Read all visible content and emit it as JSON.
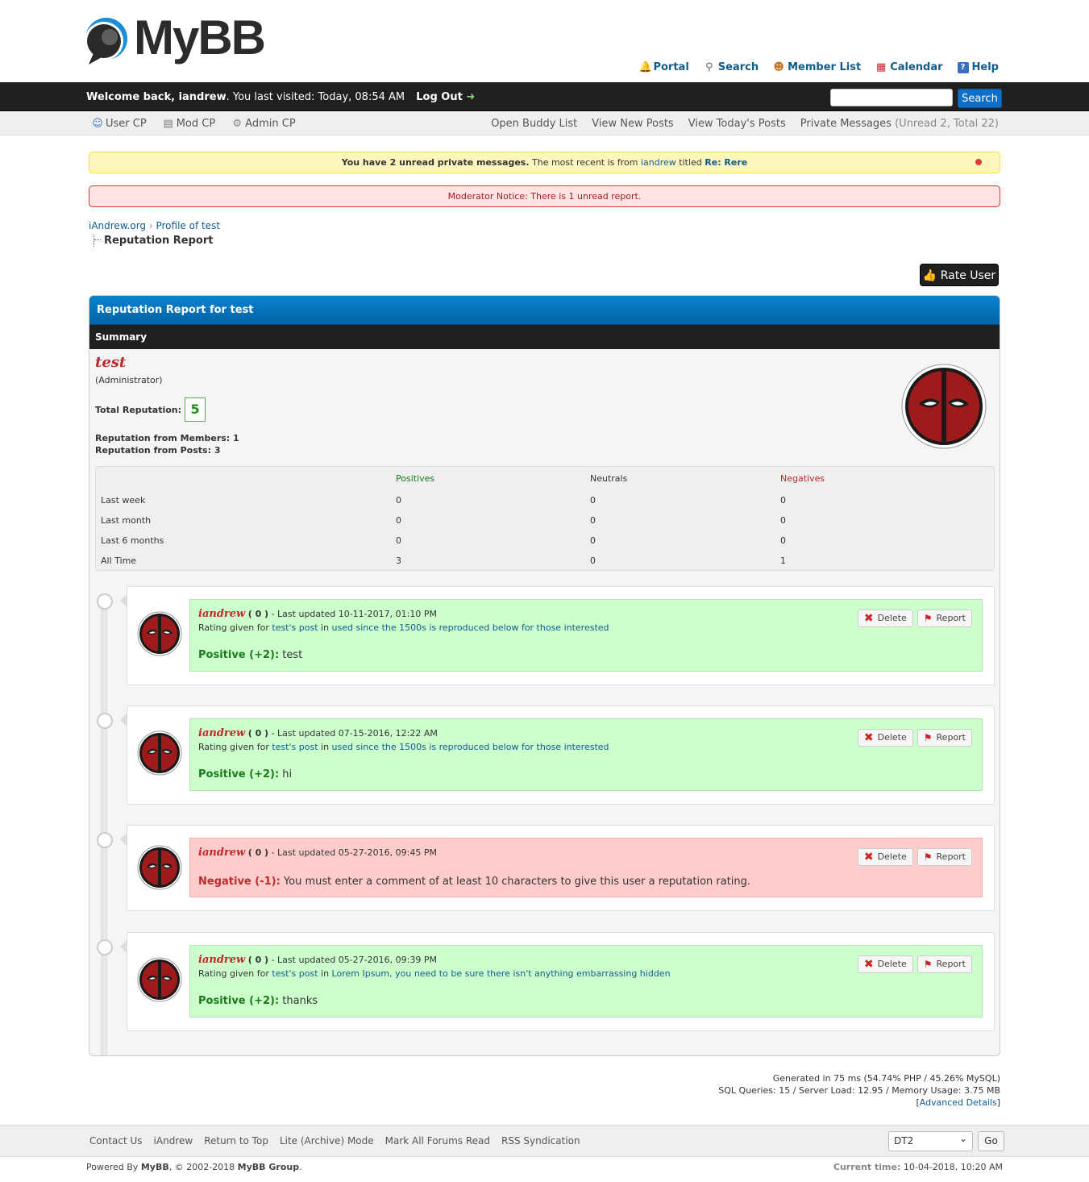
{
  "logo": {
    "text": "MyBB"
  },
  "top_links": [
    {
      "icon": "bell-icon",
      "label": "Portal"
    },
    {
      "icon": "magnifier-icon",
      "label": "Search"
    },
    {
      "icon": "members-icon",
      "label": "Member List"
    },
    {
      "icon": "calendar-icon",
      "label": "Calendar"
    },
    {
      "icon": "help-icon",
      "label": "Help"
    }
  ],
  "welcome": {
    "prefix": "Welcome back, ",
    "user": "iandrew",
    "last_visit": ". You last visited: Today, 08:54 AM",
    "logout": "Log Out",
    "search_placeholder": "",
    "search_button": "Search"
  },
  "panel": {
    "left": [
      {
        "icon": "user-icon",
        "label": "User CP"
      },
      {
        "icon": "document-icon",
        "label": "Mod CP"
      },
      {
        "icon": "gear-icon",
        "label": "Admin CP"
      }
    ],
    "right": [
      "Open Buddy List",
      "View New Posts",
      "View Today's Posts"
    ],
    "pm_label": "Private Messages",
    "pm_counts": "(Unread 2, Total 22)"
  },
  "pm_notice": {
    "bold": "You have 2 unread private messages.",
    "text": " The most recent is from ",
    "from": "iandrew",
    "titled": " titled ",
    "subject": "Re: Rere"
  },
  "mod_notice": "Moderator Notice: There is 1 unread report.",
  "breadcrumb": {
    "home": "iAndrew.org",
    "sep": " › ",
    "profile": "Profile of test",
    "current": "Reputation Report"
  },
  "rate_button": "Rate User",
  "report": {
    "title": "Reputation Report for test",
    "summary_label": "Summary",
    "username": "test",
    "usertitle": "(Administrator)",
    "total_label": "Total Reputation:",
    "total_value": "5",
    "from_members": "Reputation from Members: 1",
    "from_posts": "Reputation from Posts: 3",
    "stats_headers": [
      "",
      "Positives",
      "Neutrals",
      "Negatives"
    ],
    "stats_rows": [
      [
        "Last week",
        "0",
        "0",
        "0"
      ],
      [
        "Last month",
        "0",
        "0",
        "0"
      ],
      [
        "Last 6 months",
        "0",
        "0",
        "0"
      ],
      [
        "All Time",
        "3",
        "0",
        "1"
      ]
    ]
  },
  "entries": [
    {
      "user": "iandrew",
      "rep": "( 0 )",
      "updated": " - Last updated 10-11-2017, 01:10 PM",
      "given_for": "Rating given for ",
      "post": "test's post",
      "in": " in ",
      "thread": "used since the 1500s is reproduced below for those interested",
      "type": "Positive (+2):",
      "comment": " test",
      "tone": "good"
    },
    {
      "user": "iandrew",
      "rep": "( 0 )",
      "updated": " - Last updated 07-15-2016, 12:22 AM",
      "given_for": "Rating given for ",
      "post": "test's post",
      "in": " in ",
      "thread": "used since the 1500s is reproduced below for those interested",
      "type": "Positive (+2):",
      "comment": " hi",
      "tone": "good"
    },
    {
      "user": "iandrew",
      "rep": "( 0 )",
      "updated": " - Last updated 05-27-2016, 09:45 PM",
      "type": "Negative (-1):",
      "comment": " You must enter a comment of at least 10 characters to give this user a reputation rating.",
      "tone": "bad"
    },
    {
      "user": "iandrew",
      "rep": "( 0 )",
      "updated": " - Last updated 05-27-2016, 09:39 PM",
      "given_for": "Rating given for ",
      "post": "test's post",
      "in": " in ",
      "thread": "Lorem Ipsum, you need to be sure there isn't anything embarrassing hidden",
      "type": "Positive (+2):",
      "comment": " thanks",
      "tone": "good"
    }
  ],
  "entry_buttons": {
    "delete": "Delete",
    "report": "Report"
  },
  "debug": {
    "line1": "Generated in 75 ms (54.74% PHP / 45.26% MySQL)",
    "line2": "SQL Queries: 15 / Server Load: 12.95 / Memory Usage: 3.75 MB",
    "advanced": "Advanced Details"
  },
  "footer": {
    "links": [
      "Contact Us",
      "iAndrew",
      "Return to Top",
      "Lite (Archive) Mode",
      "Mark All Forums Read",
      "RSS Syndication"
    ],
    "theme": "DT2",
    "go": "Go",
    "powered_prefix": "Powered By ",
    "powered_mybb": "MyBB",
    "powered_mid": ", © 2002-2018 ",
    "powered_group": "MyBB Group",
    "powered_end": ".",
    "time_label": "Current time:",
    "time_value": " 10-04-2018, 10:20 AM"
  },
  "colors": {
    "accent": "#0f6fc6",
    "header_bar": "#202020",
    "positive": "#1c7a1c",
    "negative": "#c0282a"
  }
}
